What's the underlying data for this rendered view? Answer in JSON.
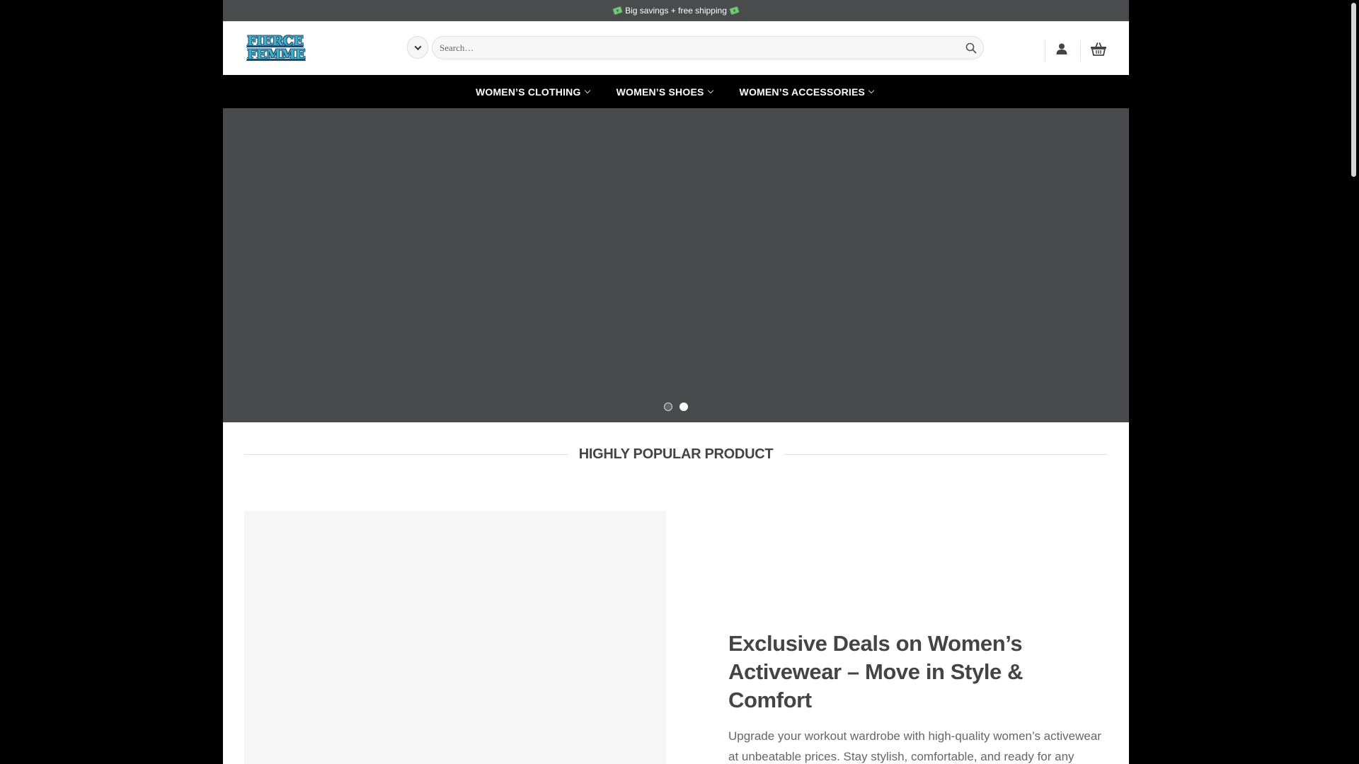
{
  "top_bar": {
    "text": "Big savings + free shipping"
  },
  "header": {
    "logo_line1": "FIERCE",
    "logo_line2": "FEMME",
    "search_placeholder": "Search…",
    "icons": {
      "category": "chevron-down-icon",
      "search": "search-icon",
      "account": "user-icon",
      "cart": "basket-icon"
    }
  },
  "nav": {
    "items": [
      {
        "label": "Women’s Clothing"
      },
      {
        "label": "Women’s Shoes"
      },
      {
        "label": "Women’s Accessories"
      }
    ]
  },
  "hero": {
    "slides_total": 2,
    "active_slide": 2
  },
  "section": {
    "title": "Highly Popular Product"
  },
  "product": {
    "heading": "Exclusive Deals on Women’s Activewear – Move in Style & Comfort",
    "description": "Upgrade your workout wardrobe with high-quality women’s activewear at unbeatable prices. Stay stylish, comfortable, and ready for any activity. Limited-time savings – shop now and power up your"
  },
  "colors": {
    "top_bar_bg": "#4a4b4d",
    "nav_bg": "#000000",
    "hero_bg": "#494a4c",
    "logo": "#3fb2c9",
    "heading_text": "#444444"
  }
}
